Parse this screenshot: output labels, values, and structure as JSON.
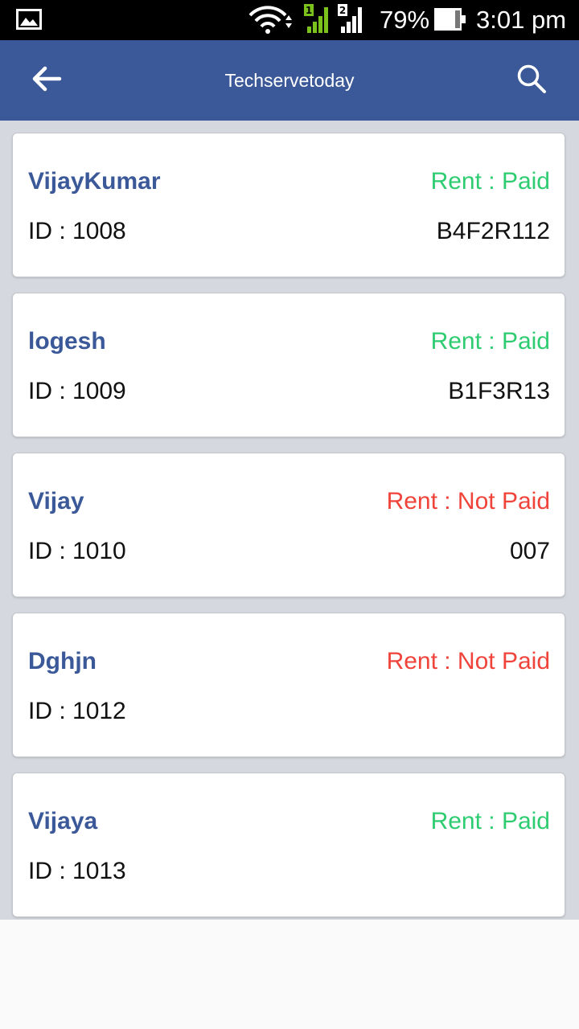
{
  "status_bar": {
    "battery_percent": "79%",
    "time": "3:01 pm",
    "icons": [
      "gallery-icon",
      "wifi-icon",
      "sim1-signal-icon",
      "sim2-signal-icon",
      "battery-icon"
    ]
  },
  "app_bar": {
    "title": "Techservetoday",
    "back_icon": "arrow-left-icon",
    "search_icon": "search-icon"
  },
  "colors": {
    "app_bar": "#3b5998",
    "name": "#3b5998",
    "paid": "#2ecc71",
    "not_paid": "#f0433a"
  },
  "tenants": [
    {
      "name": "VijayKumar",
      "rent_status": "Rent : Paid",
      "paid": true,
      "id_text": "ID : 1008",
      "room": "B4F2R112"
    },
    {
      "name": "logesh",
      "rent_status": "Rent : Paid",
      "paid": true,
      "id_text": "ID : 1009",
      "room": "B1F3R13"
    },
    {
      "name": "Vijay",
      "rent_status": "Rent : Not Paid",
      "paid": false,
      "id_text": "ID : 1010",
      "room": "007"
    },
    {
      "name": "Dghjn",
      "rent_status": "Rent : Not Paid",
      "paid": false,
      "id_text": "ID : 1012",
      "room": ""
    },
    {
      "name": "Vijaya",
      "rent_status": "Rent : Paid",
      "paid": true,
      "id_text": "ID : 1013",
      "room": ""
    }
  ]
}
